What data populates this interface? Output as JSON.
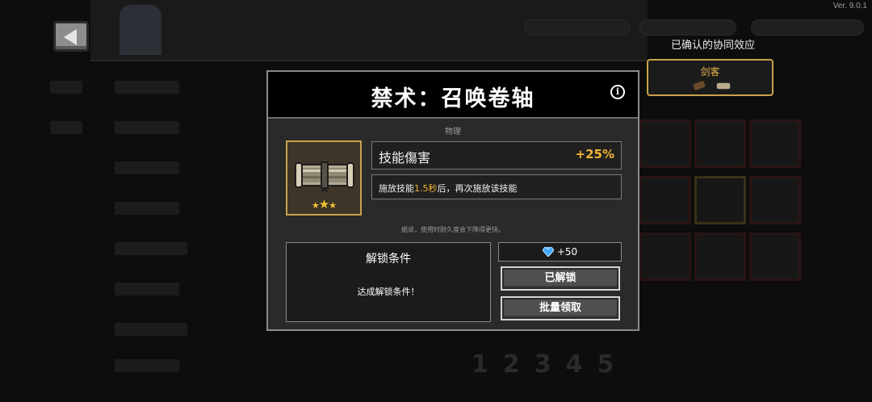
{
  "version": "Ver. 9.0.1",
  "background": {
    "pages": [
      "1",
      "2",
      "3",
      "4",
      "5"
    ]
  },
  "synergy": {
    "title": "已确认的协同效应",
    "card_name": "剑客"
  },
  "modal": {
    "title": "禁术：召唤卷轴",
    "info_icon": "i",
    "category": "物理",
    "item_icon": "scroll-icon",
    "stars": 3,
    "stat": {
      "label": "技能傷害",
      "value": "+25%"
    },
    "description": {
      "prefix": "施放技能",
      "highlight": "1.5秒",
      "suffix": "后，再次施放该技能"
    },
    "note": "据说，使用时耐久度会下降得更快。",
    "unlock": {
      "title": "解锁条件",
      "text": "达成解锁条件！"
    },
    "reward": "+50",
    "buttons": {
      "unlocked": "已解锁",
      "batch": "批量领取"
    }
  },
  "colors": {
    "accent_gold": "#f1b532",
    "frame_gold": "#c9a24a",
    "gem_blue": "#3fa9ff"
  }
}
